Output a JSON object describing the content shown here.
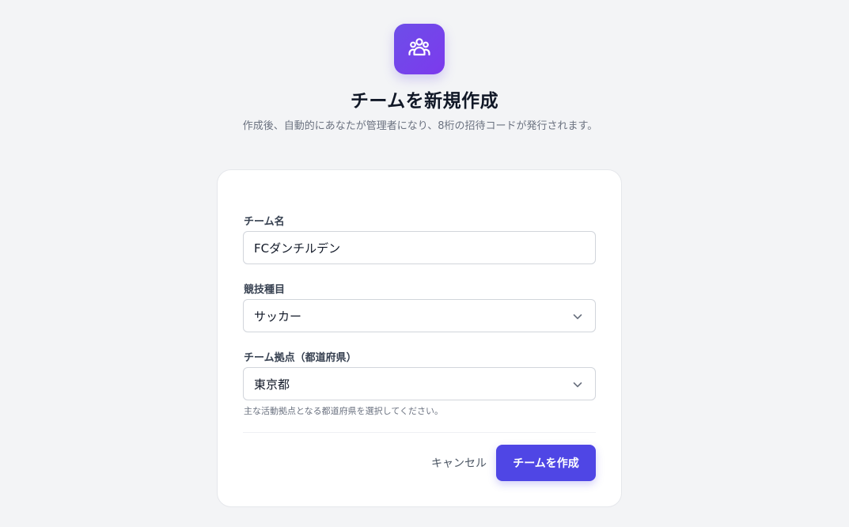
{
  "header": {
    "logo_icon": "team-users-icon",
    "title": "チームを新規作成",
    "subtitle": "作成後、自動的にあなたが管理者になり、8桁の招待コードが発行されます。"
  },
  "form": {
    "team_name": {
      "label": "チーム名",
      "value": "FCダンチルデン"
    },
    "sport": {
      "label": "競技種目",
      "value": "サッカー",
      "icon": "chevron-down-icon"
    },
    "prefecture": {
      "label": "チーム拠点（都道府県）",
      "value": "東京都",
      "icon": "chevron-down-icon",
      "hint": "主な活動拠点となる都道府県を選択してください。"
    }
  },
  "actions": {
    "cancel_label": "キャンセル",
    "submit_label": "チームを作成"
  },
  "colors": {
    "accent": "#4f46e5",
    "logo_gradient_start": "#6d4ee8",
    "logo_gradient_end": "#7c3aed",
    "background": "#f3f4f6"
  }
}
